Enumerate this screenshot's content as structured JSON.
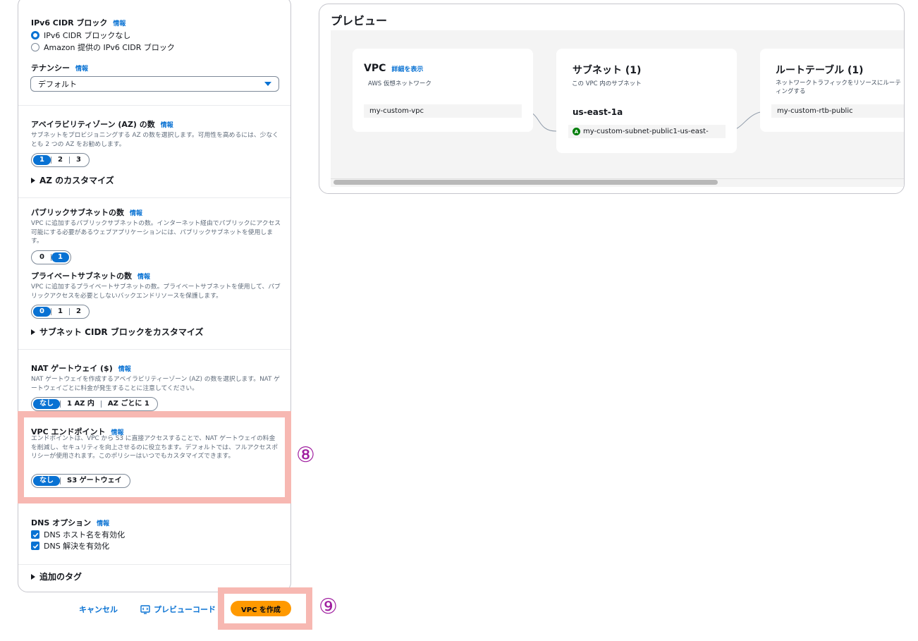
{
  "form": {
    "ipv6": {
      "label": "IPv6 CIDR ブロック",
      "info": "情報",
      "options": [
        "IPv6 CIDR ブロックなし",
        "Amazon 提供の IPv6 CIDR ブロック"
      ],
      "selected": "IPv6 CIDR ブロックなし"
    },
    "tenancy": {
      "label": "テナンシー",
      "info": "情報",
      "value": "デフォルト"
    },
    "az": {
      "label": "アベイラビリティゾーン (AZ) の数",
      "info": "情報",
      "desc": "サブネットをプロビジョニングする AZ の数を選択します。可用性を高めるには、少なくとも 2 つの AZ をお勧めします。",
      "options": [
        "1",
        "2",
        "3"
      ],
      "selected": "1",
      "customize": "AZ のカスタマイズ"
    },
    "public_subnets": {
      "label": "パブリックサブネットの数",
      "info": "情報",
      "desc": "VPC に追加するパブリックサブネットの数。インターネット経由でパブリックにアクセス可能にする必要があるウェブアプリケーションには、パブリックサブネットを使用します。",
      "options": [
        "0",
        "1"
      ],
      "selected": "1"
    },
    "private_subnets": {
      "label": "プライベートサブネットの数",
      "info": "情報",
      "desc": "VPC に追加するプライベートサブネットの数。プライベートサブネットを使用して、パブリックアクセスを必要としないバックエンドリソースを保護します。",
      "options": [
        "0",
        "1",
        "2"
      ],
      "selected": "0",
      "customize": "サブネット CIDR ブロックをカスタマイズ"
    },
    "nat": {
      "label": "NAT ゲートウェイ ($)",
      "info": "情報",
      "desc": "NAT ゲートウェイを作成するアベイラビリティーゾーン (AZ) の数を選択します。NAT ゲートウェイごとに料金が発生することに注意してください。",
      "options": [
        "なし",
        "1 AZ 内",
        "AZ ごとに 1"
      ],
      "selected": "なし"
    },
    "endpoints": {
      "label": "VPC エンドポイント",
      "info": "情報",
      "desc": "エンドポイントは、VPC から S3 に直接アクセスすることで、NAT ゲートウェイの料金を削減し、セキュリティを向上させるのに役立ちます。デフォルトでは、フルアクセスポリシーが使用されます。このポリシーはいつでもカスタマイズできます。",
      "options": [
        "なし",
        "S3 ゲートウェイ"
      ],
      "selected": "なし"
    },
    "dns": {
      "label": "DNS オプション",
      "info": "情報",
      "options": [
        "DNS ホスト名を有効化",
        "DNS 解決を有効化"
      ],
      "checked": [
        true,
        true
      ]
    },
    "tags": {
      "label": "追加のタグ"
    }
  },
  "annotations": {
    "step8": "⑧",
    "step9": "⑨"
  },
  "preview": {
    "title": "プレビュー",
    "vpc": {
      "title": "VPC",
      "link": "詳細を表示",
      "sub": "AWS 仮想ネットワーク",
      "resource": "my-custom-vpc"
    },
    "subnets": {
      "title": "サブネット (1)",
      "sub": "この VPC 内のサブネット",
      "az": "us-east-1a",
      "badge": "A",
      "resource": "my-custom-subnet-public1-us-east-"
    },
    "route_tables": {
      "title": "ルートテーブル (1)",
      "sub": "ネットワークトラフィックをリソースにルーティングする",
      "resource": "my-custom-rtb-public"
    }
  },
  "footer": {
    "cancel": "キャンセル",
    "preview_code": "プレビューコード",
    "create": "VPC を作成"
  },
  "colors": {
    "accent": "#0972d3",
    "primary_button": "#ff9900",
    "highlight": "#f7b8b2",
    "annotation": "#a020a0",
    "badge": "#037f0c"
  }
}
